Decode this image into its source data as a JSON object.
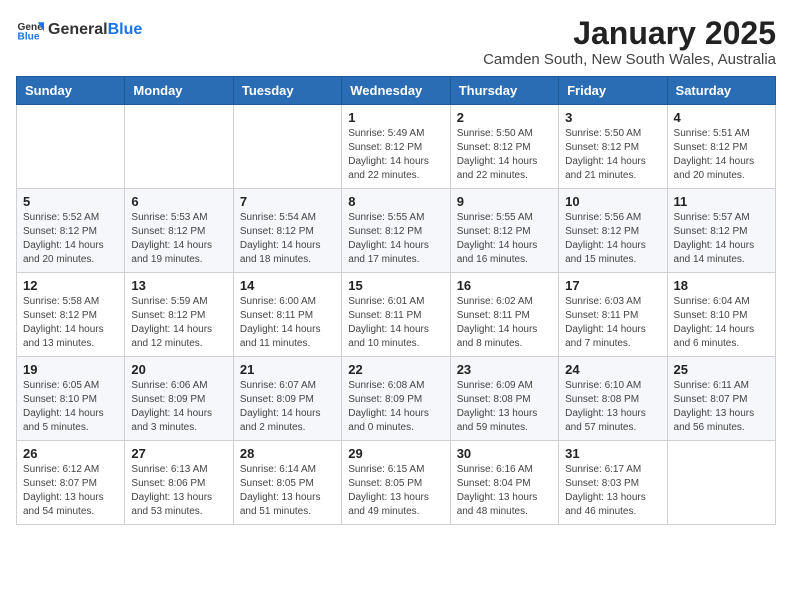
{
  "header": {
    "logo_general": "General",
    "logo_blue": "Blue",
    "month": "January 2025",
    "location": "Camden South, New South Wales, Australia"
  },
  "weekdays": [
    "Sunday",
    "Monday",
    "Tuesday",
    "Wednesday",
    "Thursday",
    "Friday",
    "Saturday"
  ],
  "weeks": [
    [
      {
        "day": "",
        "info": ""
      },
      {
        "day": "",
        "info": ""
      },
      {
        "day": "",
        "info": ""
      },
      {
        "day": "1",
        "info": "Sunrise: 5:49 AM\nSunset: 8:12 PM\nDaylight: 14 hours\nand 22 minutes."
      },
      {
        "day": "2",
        "info": "Sunrise: 5:50 AM\nSunset: 8:12 PM\nDaylight: 14 hours\nand 22 minutes."
      },
      {
        "day": "3",
        "info": "Sunrise: 5:50 AM\nSunset: 8:12 PM\nDaylight: 14 hours\nand 21 minutes."
      },
      {
        "day": "4",
        "info": "Sunrise: 5:51 AM\nSunset: 8:12 PM\nDaylight: 14 hours\nand 20 minutes."
      }
    ],
    [
      {
        "day": "5",
        "info": "Sunrise: 5:52 AM\nSunset: 8:12 PM\nDaylight: 14 hours\nand 20 minutes."
      },
      {
        "day": "6",
        "info": "Sunrise: 5:53 AM\nSunset: 8:12 PM\nDaylight: 14 hours\nand 19 minutes."
      },
      {
        "day": "7",
        "info": "Sunrise: 5:54 AM\nSunset: 8:12 PM\nDaylight: 14 hours\nand 18 minutes."
      },
      {
        "day": "8",
        "info": "Sunrise: 5:55 AM\nSunset: 8:12 PM\nDaylight: 14 hours\nand 17 minutes."
      },
      {
        "day": "9",
        "info": "Sunrise: 5:55 AM\nSunset: 8:12 PM\nDaylight: 14 hours\nand 16 minutes."
      },
      {
        "day": "10",
        "info": "Sunrise: 5:56 AM\nSunset: 8:12 PM\nDaylight: 14 hours\nand 15 minutes."
      },
      {
        "day": "11",
        "info": "Sunrise: 5:57 AM\nSunset: 8:12 PM\nDaylight: 14 hours\nand 14 minutes."
      }
    ],
    [
      {
        "day": "12",
        "info": "Sunrise: 5:58 AM\nSunset: 8:12 PM\nDaylight: 14 hours\nand 13 minutes."
      },
      {
        "day": "13",
        "info": "Sunrise: 5:59 AM\nSunset: 8:12 PM\nDaylight: 14 hours\nand 12 minutes."
      },
      {
        "day": "14",
        "info": "Sunrise: 6:00 AM\nSunset: 8:11 PM\nDaylight: 14 hours\nand 11 minutes."
      },
      {
        "day": "15",
        "info": "Sunrise: 6:01 AM\nSunset: 8:11 PM\nDaylight: 14 hours\nand 10 minutes."
      },
      {
        "day": "16",
        "info": "Sunrise: 6:02 AM\nSunset: 8:11 PM\nDaylight: 14 hours\nand 8 minutes."
      },
      {
        "day": "17",
        "info": "Sunrise: 6:03 AM\nSunset: 8:11 PM\nDaylight: 14 hours\nand 7 minutes."
      },
      {
        "day": "18",
        "info": "Sunrise: 6:04 AM\nSunset: 8:10 PM\nDaylight: 14 hours\nand 6 minutes."
      }
    ],
    [
      {
        "day": "19",
        "info": "Sunrise: 6:05 AM\nSunset: 8:10 PM\nDaylight: 14 hours\nand 5 minutes."
      },
      {
        "day": "20",
        "info": "Sunrise: 6:06 AM\nSunset: 8:09 PM\nDaylight: 14 hours\nand 3 minutes."
      },
      {
        "day": "21",
        "info": "Sunrise: 6:07 AM\nSunset: 8:09 PM\nDaylight: 14 hours\nand 2 minutes."
      },
      {
        "day": "22",
        "info": "Sunrise: 6:08 AM\nSunset: 8:09 PM\nDaylight: 14 hours\nand 0 minutes."
      },
      {
        "day": "23",
        "info": "Sunrise: 6:09 AM\nSunset: 8:08 PM\nDaylight: 13 hours\nand 59 minutes."
      },
      {
        "day": "24",
        "info": "Sunrise: 6:10 AM\nSunset: 8:08 PM\nDaylight: 13 hours\nand 57 minutes."
      },
      {
        "day": "25",
        "info": "Sunrise: 6:11 AM\nSunset: 8:07 PM\nDaylight: 13 hours\nand 56 minutes."
      }
    ],
    [
      {
        "day": "26",
        "info": "Sunrise: 6:12 AM\nSunset: 8:07 PM\nDaylight: 13 hours\nand 54 minutes."
      },
      {
        "day": "27",
        "info": "Sunrise: 6:13 AM\nSunset: 8:06 PM\nDaylight: 13 hours\nand 53 minutes."
      },
      {
        "day": "28",
        "info": "Sunrise: 6:14 AM\nSunset: 8:05 PM\nDaylight: 13 hours\nand 51 minutes."
      },
      {
        "day": "29",
        "info": "Sunrise: 6:15 AM\nSunset: 8:05 PM\nDaylight: 13 hours\nand 49 minutes."
      },
      {
        "day": "30",
        "info": "Sunrise: 6:16 AM\nSunset: 8:04 PM\nDaylight: 13 hours\nand 48 minutes."
      },
      {
        "day": "31",
        "info": "Sunrise: 6:17 AM\nSunset: 8:03 PM\nDaylight: 13 hours\nand 46 minutes."
      },
      {
        "day": "",
        "info": ""
      }
    ]
  ]
}
